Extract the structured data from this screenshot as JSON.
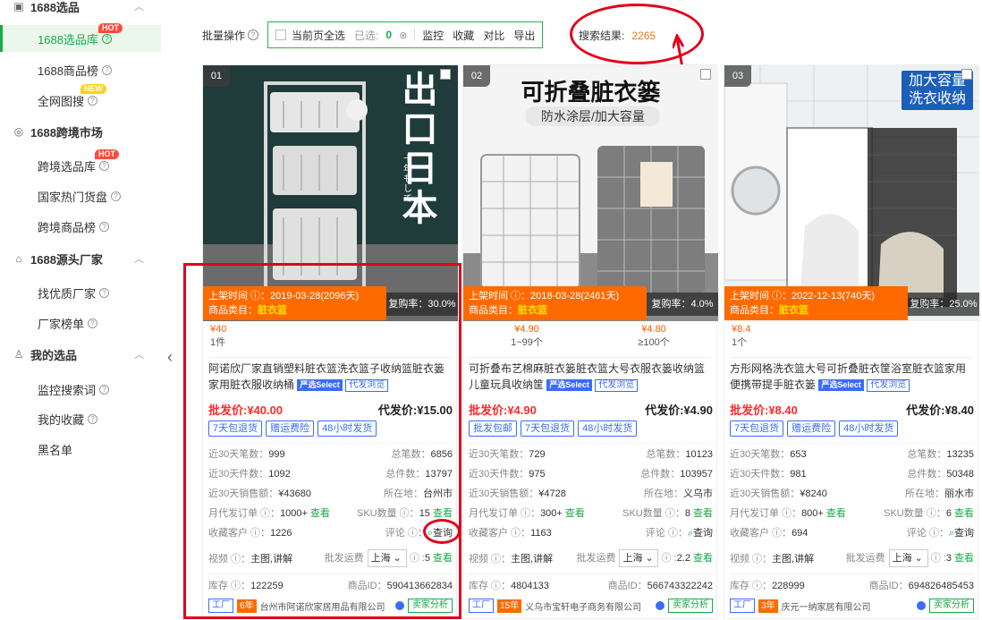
{
  "sidebar": {
    "sections": [
      {
        "icon": "selection-icon",
        "label": "1688选品",
        "items": [
          {
            "label": "1688选品库",
            "badge": "HOT",
            "active": true
          },
          {
            "label": "1688商品榜"
          },
          {
            "label": "全网图搜",
            "badge": "NEW"
          }
        ]
      },
      {
        "icon": "globe-icon",
        "label": "1688跨境市场",
        "items": [
          {
            "label": "跨境选品库",
            "badge": "HOT"
          },
          {
            "label": "国家热门货盘"
          },
          {
            "label": "跨境商品榜"
          }
        ]
      },
      {
        "icon": "factory-icon",
        "label": "1688源头厂家",
        "items": [
          {
            "label": "找优质厂家"
          },
          {
            "label": "厂家榜单"
          }
        ]
      },
      {
        "icon": "user-icon",
        "label": "我的选品",
        "items": [
          {
            "label": "监控搜索词"
          },
          {
            "label": "我的收藏"
          },
          {
            "label": "黑名单"
          }
        ]
      }
    ]
  },
  "toolbar": {
    "batch_label": "批量操作",
    "select_all": "当前页全选",
    "selected_label": "已选:",
    "selected_count": "0",
    "actions": [
      "监控",
      "收藏",
      "对比",
      "导出"
    ],
    "result_label": "搜索结果:",
    "result_count": "2265"
  },
  "products": [
    {
      "index": "01",
      "img_text": [
        "出口日本",
        "十年もして"
      ],
      "list_time": "上架时间 ⓘ：2019-03-28(2096天)",
      "category_label": "商品类目：",
      "category": "脏衣篮",
      "repurchase": "复购率：30.0%",
      "tiers": [
        {
          "price": "¥40",
          "qty": "1件"
        }
      ],
      "title": "阿诺欣厂家直销塑料脏衣篮洗衣篮子收纳篮脏衣篓家用脏衣服收纳桶",
      "tag_select": "严选Select",
      "tag_browse": "代发浏览",
      "wholesale": "批发价:¥40.00",
      "dropship": "代发价:¥15.00",
      "services": [
        "7天包退货",
        "赠运费险",
        "48小时发货"
      ],
      "stats": [
        [
          "近30天笔数：",
          "999",
          "总笔数：",
          "6856"
        ],
        [
          "近30天件数：",
          "1092",
          "总件数：",
          "13797"
        ],
        [
          "近30天销售额：",
          "¥43680",
          "所在地：",
          "台州市"
        ],
        [
          "月代发订单 ⓘ：",
          "1000+",
          "SKU数量 ⓘ：",
          "15"
        ],
        [
          "收藏客户 ⓘ：",
          "1226",
          "评论 ⓘ：",
          ""
        ]
      ],
      "query_label": "查看",
      "review_query": "查询",
      "video_label": "视频 ⓘ：",
      "video": "主图,讲解",
      "ship_label": "批发运费",
      "ship_city": "上海",
      "ship_fee": "5",
      "stock_label": "库存 ⓘ：",
      "stock": "122259",
      "pid_label": "商品ID：",
      "pid": "590413662834",
      "factory": "工厂",
      "years": "6年",
      "shop": "台州市阿诺欣家居用品有限公司",
      "analysis": "卖家分析"
    },
    {
      "index": "02",
      "img_text": [
        "可折叠脏衣篓",
        "防水涂层/加大容量"
      ],
      "list_time": "上架时间 ⓘ：2018-03-28(2461天)",
      "category_label": "商品类目：",
      "category": "脏衣篮",
      "repurchase": "复购率：4.0%",
      "tiers": [
        {
          "price": "¥4.90",
          "qty": "1~99个"
        },
        {
          "price": "¥4.80",
          "qty": "≥100个"
        }
      ],
      "title": "可折叠布艺棉麻脏衣篓脏衣篮大号衣服衣篓收纳篮儿童玩具收纳筐",
      "tag_select": "严选Select",
      "tag_browse": "代发浏览",
      "wholesale": "批发价:¥4.90",
      "dropship": "代发价:¥4.90",
      "services": [
        "批发包邮",
        "7天包退货",
        "48小时发货"
      ],
      "stats": [
        [
          "近30天笔数：",
          "729",
          "总笔数：",
          "10123"
        ],
        [
          "近30天件数：",
          "975",
          "总件数：",
          "103957"
        ],
        [
          "近30天销售额：",
          "¥4728",
          "所在地：",
          "义乌市"
        ],
        [
          "月代发订单 ⓘ：",
          "300+",
          "SKU数量 ⓘ：",
          "8"
        ],
        [
          "收藏客户 ⓘ：",
          "1163",
          "评论 ⓘ：",
          ""
        ]
      ],
      "query_label": "查看",
      "review_query": "查询",
      "video_label": "视频 ⓘ：",
      "video": "主图,讲解",
      "ship_label": "批发运费",
      "ship_city": "上海",
      "ship_fee": "2.2",
      "stock_label": "库存 ⓘ：",
      "stock": "4804133",
      "pid_label": "商品ID：",
      "pid": "566743322242",
      "factory": "工厂",
      "years": "15年",
      "shop": "义乌市宝轩电子商务有限公司",
      "analysis": "卖家分析"
    },
    {
      "index": "03",
      "img_text": [
        "加大容量",
        "洗衣收纳"
      ],
      "list_time": "上架时间 ⓘ：2022-12-13(740天)",
      "category_label": "商品类目：",
      "category": "脏衣篮",
      "repurchase": "复购率：25.0%",
      "tiers": [
        {
          "price": "¥8.4",
          "qty": "1个"
        }
      ],
      "title": "方形网格洗衣篮大号可折叠脏衣筐浴室脏衣篮家用便携带提手脏衣篓",
      "tag_select": "严选Select",
      "tag_browse": "代发浏览",
      "wholesale": "批发价:¥8.40",
      "dropship": "代发价:¥8.40",
      "services": [
        "7天包退货",
        "赠运费险",
        "48小时发货"
      ],
      "stats": [
        [
          "近30天笔数：",
          "653",
          "总笔数：",
          "13235"
        ],
        [
          "近30天件数：",
          "981",
          "总件数：",
          "50348"
        ],
        [
          "近30天销售额：",
          "¥8240",
          "所在地：",
          "丽水市"
        ],
        [
          "月代发订单 ⓘ：",
          "800+",
          "SKU数量 ⓘ：",
          "6"
        ],
        [
          "收藏客户 ⓘ：",
          "694",
          "评论 ⓘ：",
          ""
        ]
      ],
      "query_label": "查看",
      "review_query": "查询",
      "video_label": "视频 ⓘ：",
      "video": "主图,讲解",
      "ship_label": "批发运费",
      "ship_city": "上海",
      "ship_fee": "3",
      "stock_label": "库存 ⓘ：",
      "stock": "228999",
      "pid_label": "商品ID：",
      "pid": "694826485453",
      "factory": "工厂",
      "years": "3年",
      "shop": "庆元一纳家居有限公司",
      "analysis": "卖家分析"
    }
  ]
}
